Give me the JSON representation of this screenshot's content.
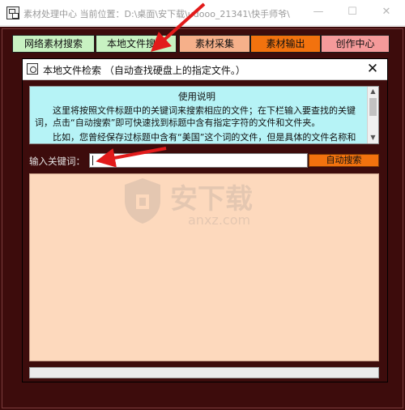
{
  "window": {
    "title": "素材处理中心   当前位置：D:\\桌面\\安下载\\udooo_21341\\快手师爷\\",
    "minimize_glyph": "—",
    "maximize_glyph": "☐",
    "close_glyph": "✕"
  },
  "nav": [
    {
      "label": "网络素材搜索",
      "bg": "#c8f2c2"
    },
    {
      "label": "本地文件搜索",
      "bg": "#c8f2c2"
    },
    {
      "label": "素材采集",
      "bg": "#f6b08a"
    },
    {
      "label": "素材输出",
      "bg": "#f2720e"
    },
    {
      "label": "创作中心",
      "bg": "#f59a9a"
    }
  ],
  "dialog": {
    "title": "本地文件检索 （自动查找硬盘上的指定文件。）",
    "close_glyph": "✕",
    "usage": {
      "heading": "使用说明",
      "paragraph1": "这里将按照文件标题中的关键词来搜索相应的文件；在下栏输入要查找的关键词，点击“自动搜索”即可快速找到标题中含有指定字符的文件和文件夹。",
      "paragraph2": "比如，您曾经保存过标题中含有“美国”这个词的文件，但是具体的文件名称和"
    },
    "keyword_label": "输入关键词：",
    "keyword_value": "",
    "search_button": "自动搜索",
    "results_text": "",
    "status_text": ""
  },
  "watermark": {
    "brand_cn": "安下载",
    "brand_en": "anxz.com"
  },
  "colors": {
    "frame_bg": "#3d0c0c",
    "info_bg": "#b6f3f6",
    "results_bg": "#fdd9bd",
    "accent_orange": "#f2720e",
    "annotation_red": "#e21b1b"
  }
}
